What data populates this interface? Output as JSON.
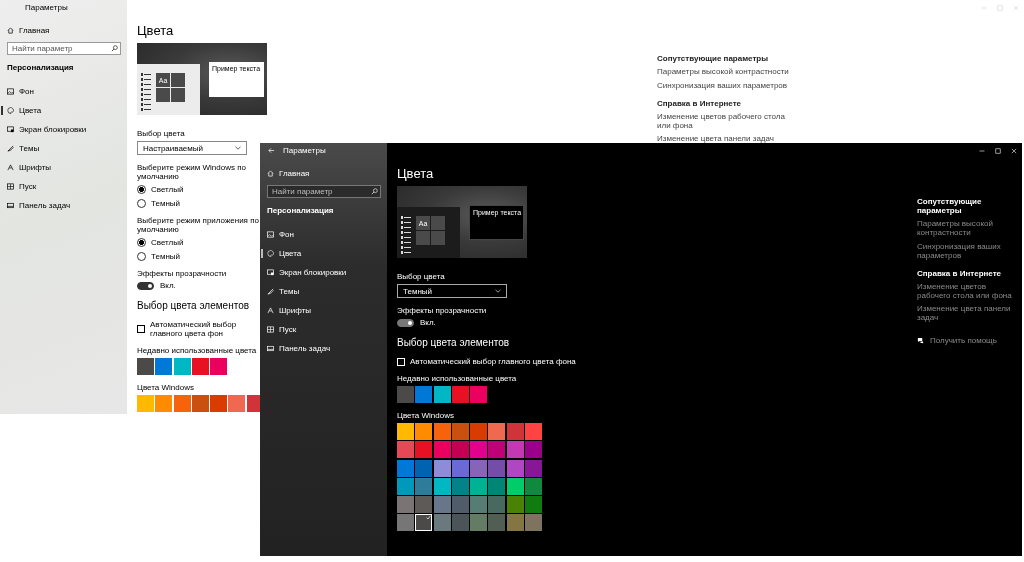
{
  "light_window": {
    "dark": false,
    "title": "Параметры",
    "back_button": false,
    "window_controls": true,
    "nav": {
      "home": "Главная",
      "search_placeholder": "Найти параметр",
      "section": "Персонализация",
      "items": [
        {
          "label": "Фон",
          "selected": false
        },
        {
          "label": "Цвета",
          "selected": true
        },
        {
          "label": "Экран блокировки",
          "selected": false
        },
        {
          "label": "Темы",
          "selected": false
        },
        {
          "label": "Шрифты",
          "selected": false
        },
        {
          "label": "Пуск",
          "selected": false
        },
        {
          "label": "Панель задач",
          "selected": false
        }
      ]
    },
    "page_title": "Цвета",
    "preview": {
      "tile_text": "Aa",
      "sample_text": "Пример текста"
    },
    "settings": [
      {
        "kind": "dropdown",
        "label": "Выбор цвета",
        "value": "Настраиваемый"
      },
      {
        "kind": "radio",
        "label": "Выберите режим Windows по умолчанию",
        "options": [
          {
            "label": "Светлый",
            "selected": true
          },
          {
            "label": "Темный",
            "selected": false
          }
        ]
      },
      {
        "kind": "radio",
        "label": "Выберите режим приложения по умолчанию",
        "options": [
          {
            "label": "Светлый",
            "selected": true
          },
          {
            "label": "Темный",
            "selected": false
          }
        ]
      },
      {
        "kind": "toggle",
        "label": "Эффекты прозрачности",
        "on": true,
        "state_text": "Вкл."
      },
      {
        "kind": "heading",
        "text": "Выбор цвета элементов"
      },
      {
        "kind": "checkbox",
        "label": "Автоматический выбор главного цвета фон",
        "checked": false
      },
      {
        "kind": "swatches",
        "label": "Недавно использованные цвета",
        "colors": [
          {
            "color": "#4c4a48",
            "selected": false
          },
          {
            "color": "#0078d7",
            "selected": false
          },
          {
            "color": "#00b7c3",
            "selected": false
          },
          {
            "color": "#e81123",
            "selected": false
          },
          {
            "color": "#ea005e",
            "selected": false
          }
        ]
      },
      {
        "kind": "swatches",
        "label": "Цвета Windows",
        "colors": [
          {
            "color": "#ffb900",
            "selected": false
          },
          {
            "color": "#ff8c00",
            "selected": false
          },
          {
            "color": "#f7630c",
            "selected": false
          },
          {
            "color": "#ca5010",
            "selected": false
          },
          {
            "color": "#da3b01",
            "selected": false
          },
          {
            "color": "#ef6950",
            "selected": false
          },
          {
            "color": "#d13438",
            "selected": false
          }
        ]
      }
    ],
    "related": {
      "heading": "Сопутствующие параметры",
      "links": [
        "Параметры высокой контрастности",
        "Синхронизация ваших параметров"
      ]
    },
    "help": {
      "heading": "Справка в Интернете",
      "links": [
        "Изменение цветов рабочего стола или фона",
        "Изменение цвета панели задач"
      ]
    }
  },
  "dark_window": {
    "dark": true,
    "title": "Параметры",
    "back_button": true,
    "window_controls": true,
    "nav": {
      "home": "Главная",
      "search_placeholder": "Найти параметр",
      "section": "Персонализация",
      "items": [
        {
          "label": "Фон",
          "selected": false
        },
        {
          "label": "Цвета",
          "selected": true
        },
        {
          "label": "Экран блокировки",
          "selected": false
        },
        {
          "label": "Темы",
          "selected": false
        },
        {
          "label": "Шрифты",
          "selected": false
        },
        {
          "label": "Пуск",
          "selected": false
        },
        {
          "label": "Панель задач",
          "selected": false
        }
      ]
    },
    "page_title": "Цвета",
    "preview": {
      "tile_text": "Aa",
      "sample_text": "Пример текста"
    },
    "settings": [
      {
        "kind": "dropdown",
        "label": "Выбор цвета",
        "value": "Темный"
      },
      {
        "kind": "toggle",
        "label": "Эффекты прозрачности",
        "on": true,
        "state_text": "Вкл."
      },
      {
        "kind": "heading",
        "text": "Выбор цвета элементов"
      },
      {
        "kind": "checkbox",
        "label": "Автоматический выбор главного цвета фона",
        "checked": false
      },
      {
        "kind": "swatches",
        "label": "Недавно использованные цвета",
        "colors": [
          {
            "color": "#4c4a48",
            "selected": false
          },
          {
            "color": "#0078d7",
            "selected": false
          },
          {
            "color": "#00b7c3",
            "selected": false
          },
          {
            "color": "#e81123",
            "selected": false
          },
          {
            "color": "#ea005e",
            "selected": false
          }
        ]
      },
      {
        "kind": "swatches",
        "label": "Цвета Windows",
        "colors": [
          {
            "color": "#ffb900",
            "selected": false
          },
          {
            "color": "#ff8c00",
            "selected": false
          },
          {
            "color": "#f7630c",
            "selected": false
          },
          {
            "color": "#ca5010",
            "selected": false
          },
          {
            "color": "#da3b01",
            "selected": false
          },
          {
            "color": "#ef6950",
            "selected": false
          },
          {
            "color": "#d13438",
            "selected": false
          },
          {
            "color": "#ff4343",
            "selected": false
          },
          {
            "color": "#e74856",
            "selected": false
          },
          {
            "color": "#e81123",
            "selected": false
          },
          {
            "color": "#ea005e",
            "selected": false
          },
          {
            "color": "#c30052",
            "selected": false
          },
          {
            "color": "#e3008c",
            "selected": false
          },
          {
            "color": "#bf0077",
            "selected": false
          },
          {
            "color": "#c239b3",
            "selected": false
          },
          {
            "color": "#9a0089",
            "selected": false
          },
          {
            "color": "#0078d7",
            "selected": false
          },
          {
            "color": "#0063b1",
            "selected": false
          },
          {
            "color": "#8e8cd8",
            "selected": false
          },
          {
            "color": "#6b69d6",
            "selected": false
          },
          {
            "color": "#8764b8",
            "selected": false
          },
          {
            "color": "#744da9",
            "selected": false
          },
          {
            "color": "#b146c2",
            "selected": false
          },
          {
            "color": "#881798",
            "selected": false
          },
          {
            "color": "#0099bc",
            "selected": false
          },
          {
            "color": "#2d7d9a",
            "selected": false
          },
          {
            "color": "#00b7c3",
            "selected": false
          },
          {
            "color": "#038387",
            "selected": false
          },
          {
            "color": "#00b294",
            "selected": false
          },
          {
            "color": "#018574",
            "selected": false
          },
          {
            "color": "#00cc6a",
            "selected": false
          },
          {
            "color": "#10893e",
            "selected": false
          },
          {
            "color": "#7a7574",
            "selected": false
          },
          {
            "color": "#5d5a58",
            "selected": false
          },
          {
            "color": "#68768a",
            "selected": false
          },
          {
            "color": "#515c6b",
            "selected": false
          },
          {
            "color": "#567c73",
            "selected": false
          },
          {
            "color": "#486860",
            "selected": false
          },
          {
            "color": "#498205",
            "selected": false
          },
          {
            "color": "#107c10",
            "selected": false
          },
          {
            "color": "#767676",
            "selected": false
          },
          {
            "color": "#4c4a48",
            "selected": true
          },
          {
            "color": "#69797e",
            "selected": false
          },
          {
            "color": "#4a5459",
            "selected": false
          },
          {
            "color": "#647c64",
            "selected": false
          },
          {
            "color": "#525e54",
            "selected": false
          },
          {
            "color": "#847545",
            "selected": false
          },
          {
            "color": "#7e735f",
            "selected": false
          }
        ]
      }
    ],
    "related": {
      "heading": "Сопутствующие параметры",
      "links": [
        "Параметры высокой контрастности",
        "Синхронизация ваших параметров"
      ]
    },
    "help": {
      "heading": "Справка в Интернете",
      "links": [
        "Изменение цветов рабочего стола или фона",
        "Изменение цвета панели задач"
      ]
    },
    "get_help": "Получить помощь"
  }
}
